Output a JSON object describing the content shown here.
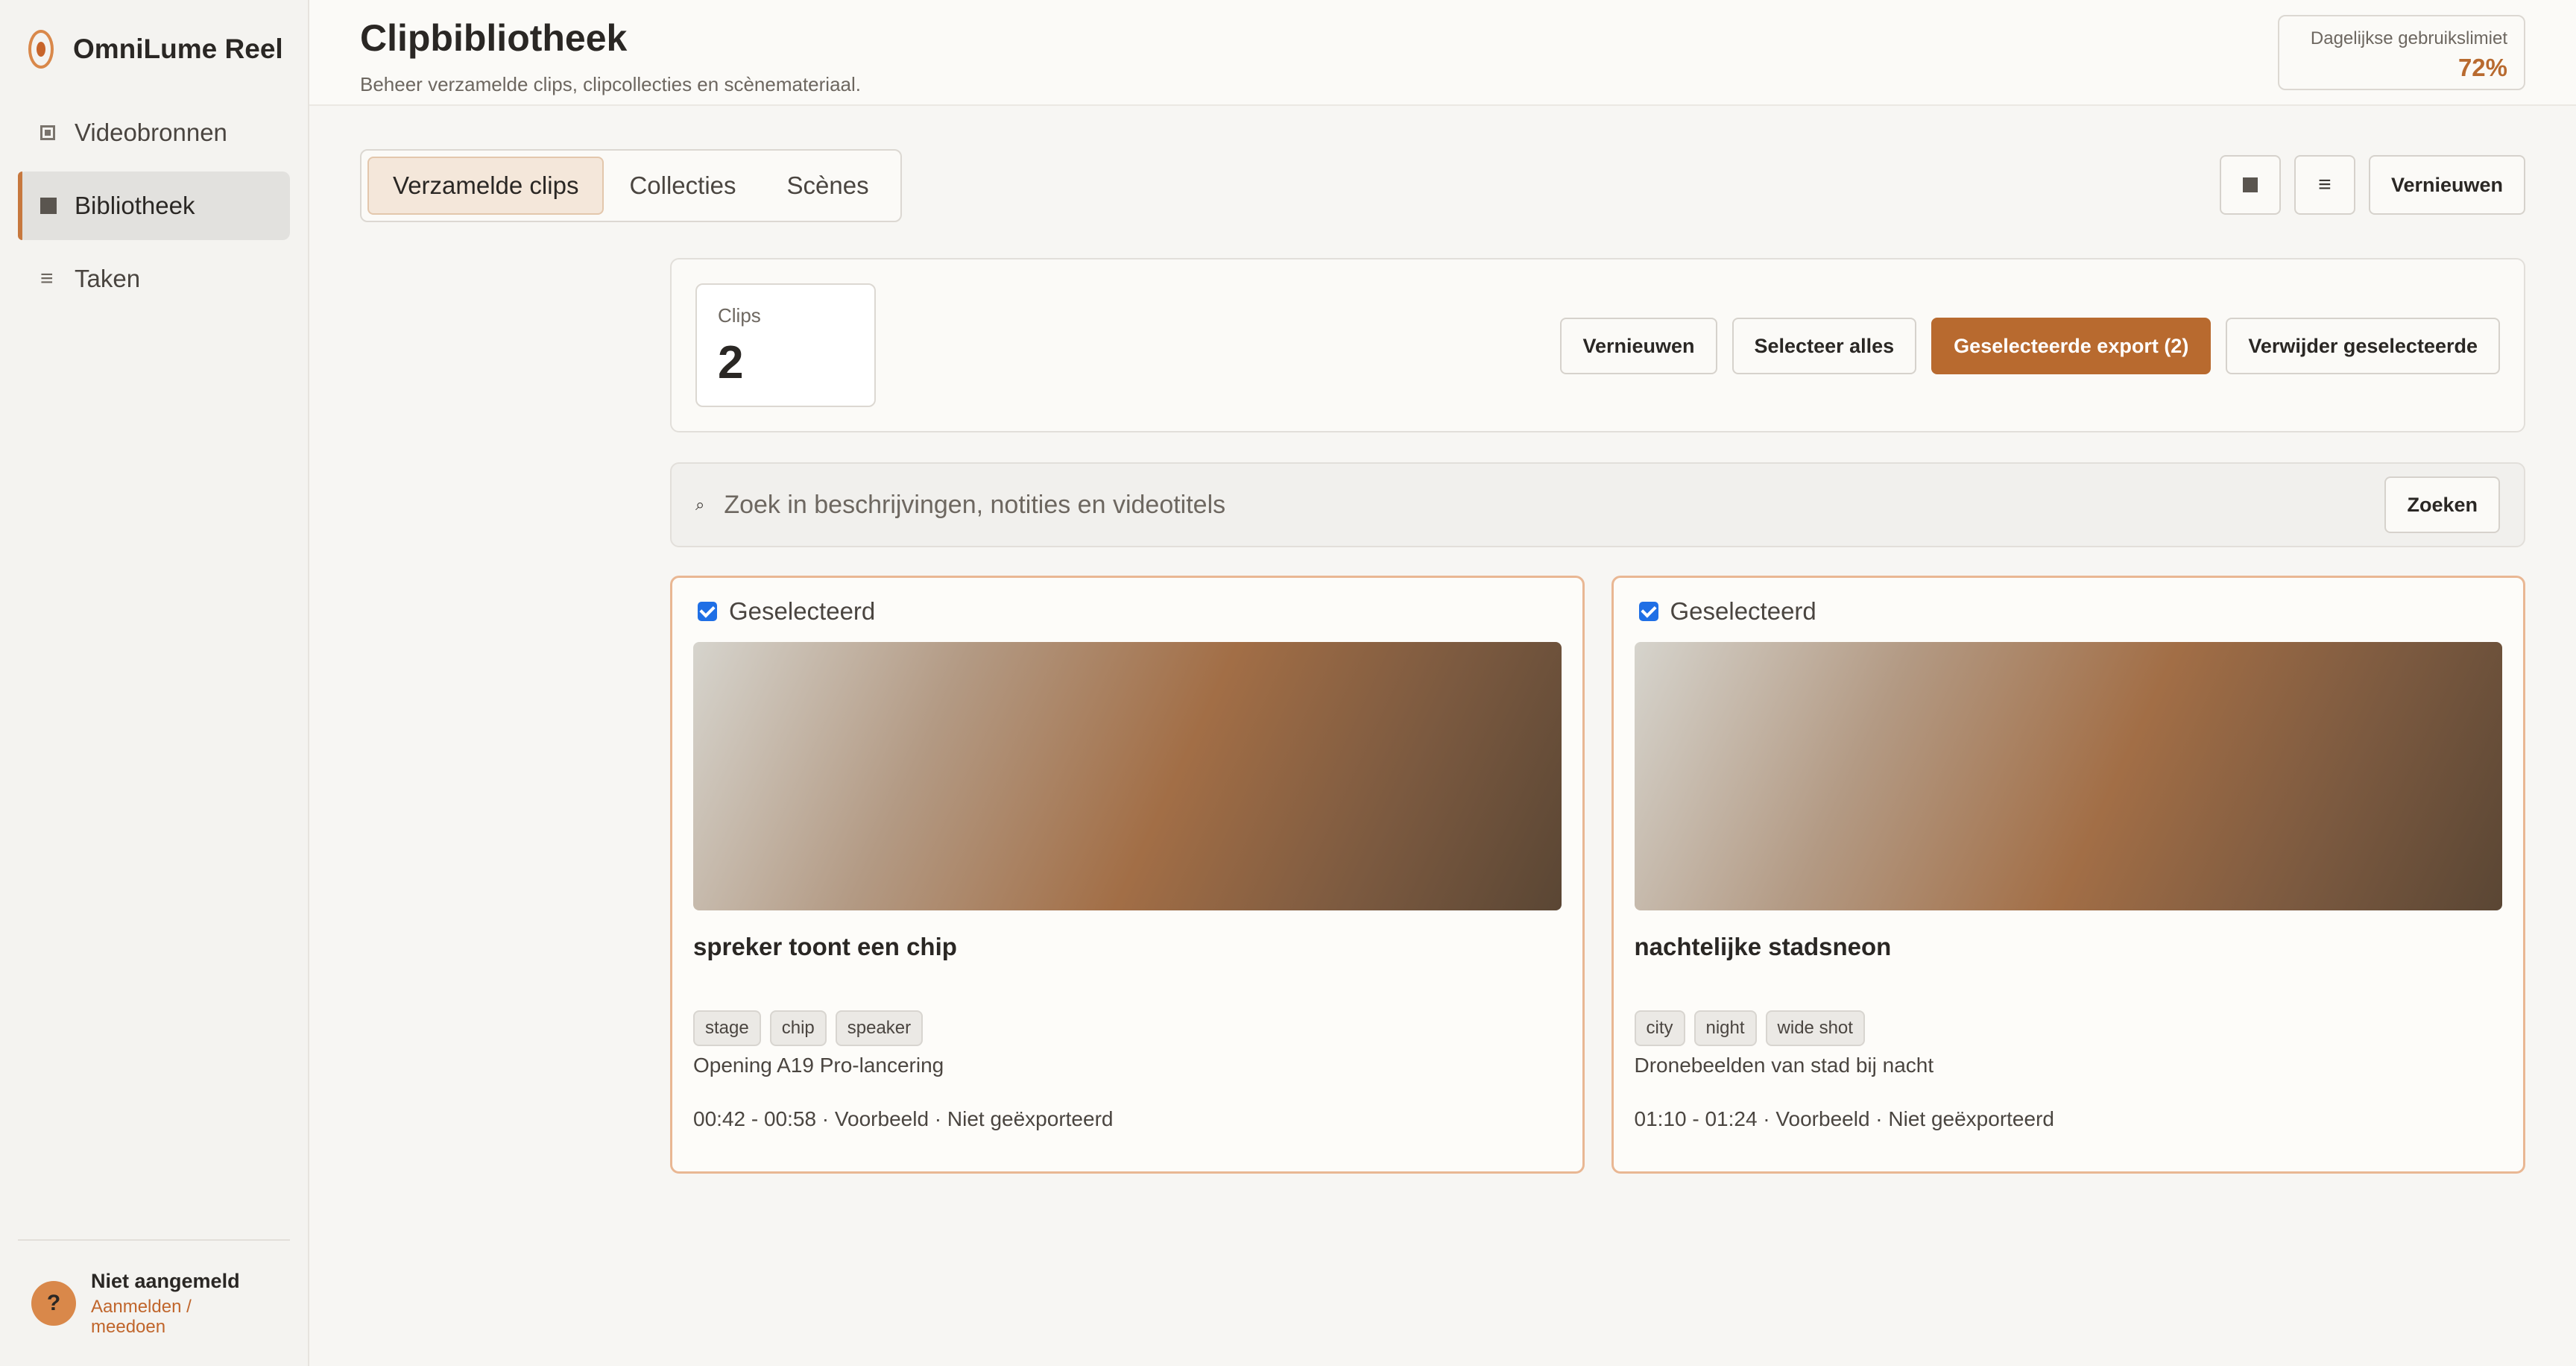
{
  "app": {
    "name": "OmniLume Reel",
    "logo_icon": "omnilume-logo-icon"
  },
  "sidebar": {
    "items": [
      {
        "label": "Videobronnen",
        "icon": "video-source-icon",
        "active": false
      },
      {
        "label": "Bibliotheek",
        "icon": "library-icon",
        "active": true
      },
      {
        "label": "Taken",
        "icon": "list-icon",
        "active": false
      }
    ],
    "footer": {
      "avatar_glyph": "?",
      "user_status": "Niet aangemeld",
      "auth_link": "Aanmelden / meedoen"
    }
  },
  "header": {
    "title": "Clipbibliotheek",
    "subtitle": "Beheer verzamelde clips, clipcollecties en scènemateriaal.",
    "usage": {
      "label": "Dagelijkse gebruikslimiet",
      "value": "72%"
    }
  },
  "tabs": [
    {
      "label": "Verzamelde clips",
      "active": true
    },
    {
      "label": "Collecties",
      "active": false
    },
    {
      "label": "Scènes",
      "active": false
    }
  ],
  "toolbar": {
    "grid_view_icon": "grid-view-icon",
    "list_view_icon": "list-view-icon",
    "refresh_label": "Vernieuwen"
  },
  "stats": {
    "label": "Clips",
    "value": "2"
  },
  "actions": {
    "refresh": "Vernieuwen",
    "select_all": "Selecteer alles",
    "export_selected": "Geselecteerde export (2)",
    "delete_selected": "Verwijder geselecteerde"
  },
  "search": {
    "placeholder": "Zoek in beschrijvingen, notities en videotitels",
    "value": "",
    "button": "Zoeken"
  },
  "clips": [
    {
      "selected_label": "Geselecteerd",
      "title": "spreker toont een chip",
      "tags": [
        "stage",
        "chip",
        "speaker"
      ],
      "description": "Opening A19 Pro-lancering",
      "meta": "00:42 - 00:58 · Voorbeeld · Niet geëxporteerd"
    },
    {
      "selected_label": "Geselecteerd",
      "title": "nachtelijke stadsneon",
      "tags": [
        "city",
        "night",
        "wide shot"
      ],
      "description": "Dronebeelden van stad bij nacht",
      "meta": "01:10 - 01:24 · Voorbeeld · Niet geëxporteerd"
    }
  ],
  "colors": {
    "accent": "#b86a2f",
    "accent_light": "#d9884a",
    "checkbox": "#1f6fe5",
    "card_border": "#e9b793"
  }
}
